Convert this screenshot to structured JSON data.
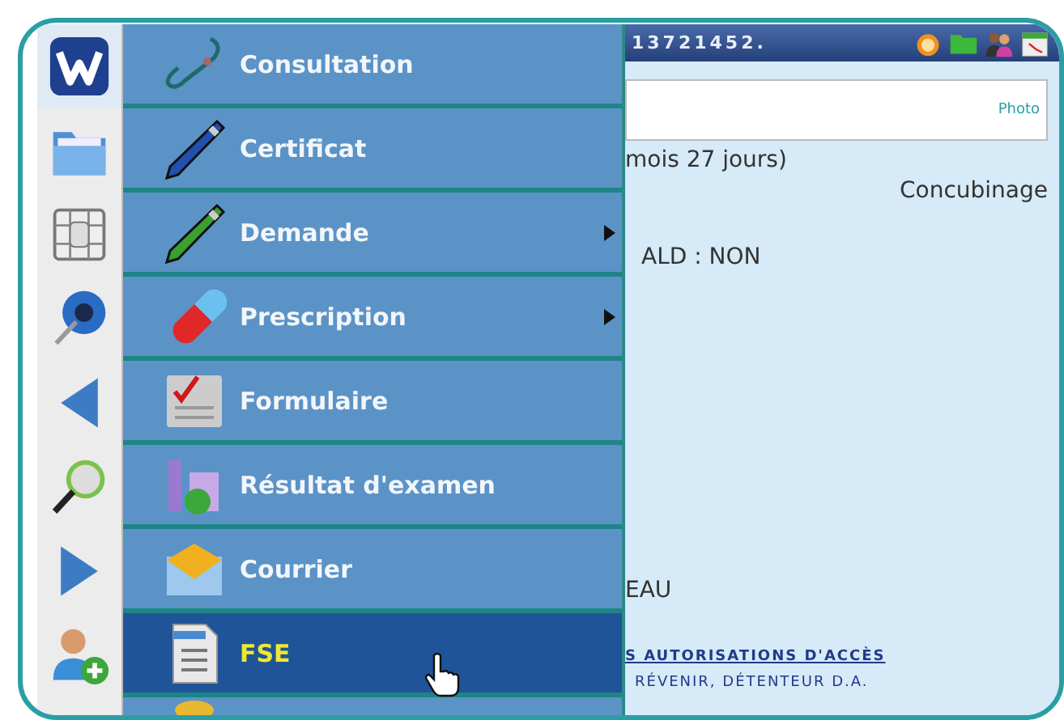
{
  "menu": [
    {
      "label": "Consultation",
      "selected": false,
      "submenu": false
    },
    {
      "label": "Certificat",
      "selected": false,
      "submenu": false
    },
    {
      "label": "Demande",
      "selected": false,
      "submenu": true
    },
    {
      "label": "Prescription",
      "selected": false,
      "submenu": true
    },
    {
      "label": "Formulaire",
      "selected": false,
      "submenu": false
    },
    {
      "label": "Résultat d'examen",
      "selected": false,
      "submenu": false
    },
    {
      "label": "Courrier",
      "selected": false,
      "submenu": false
    },
    {
      "label": "FSE",
      "selected": true,
      "submenu": false
    },
    {
      "selected": false,
      "submenu": false
    }
  ],
  "header": {
    "number": "13721452."
  },
  "photo_field": {
    "link": "Photo"
  },
  "lines": [
    {
      "kind": "text",
      "text": "mois 27 jours)"
    },
    {
      "kind": "right",
      "text": "Concubinage"
    },
    {
      "kind": "text",
      "text": "ALD : NON"
    },
    {
      "kind": "text",
      "text": "EAU"
    },
    {
      "kind": "link",
      "text": "S AUTORISATIONS D'ACCÈS"
    },
    {
      "kind": "caps",
      "text": "RÉVENIR, DÉTENTEUR D.A."
    }
  ]
}
